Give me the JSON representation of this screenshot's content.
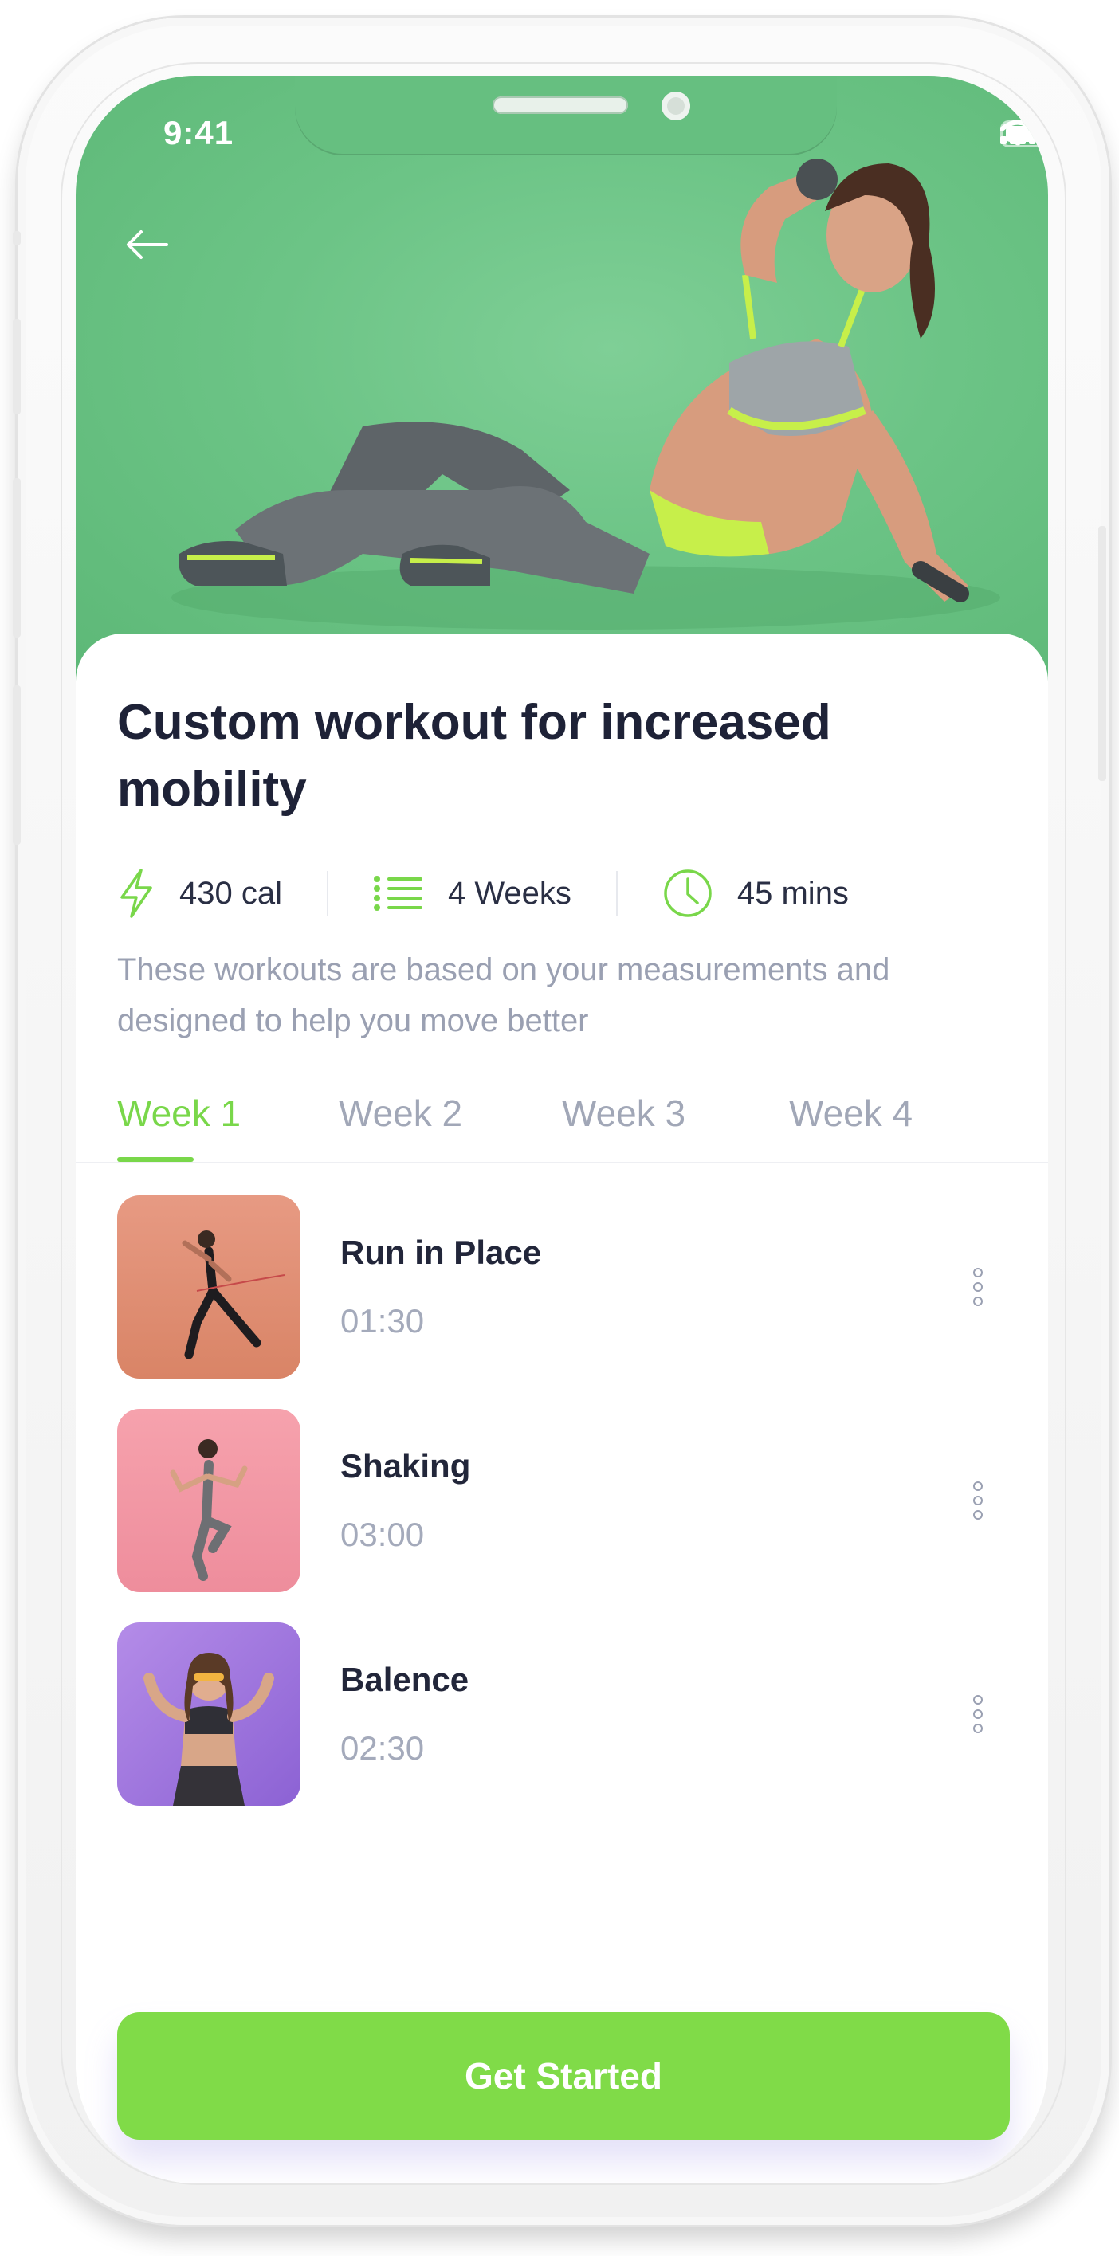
{
  "status_bar": {
    "time": "9:41",
    "icons": [
      "cellular-signal-icon",
      "wifi-icon",
      "battery-icon"
    ]
  },
  "header": {
    "back_icon": "arrow-left-icon"
  },
  "workout": {
    "title": "Custom workout for increased mobility",
    "stats": [
      {
        "icon": "lightning-icon",
        "value": "430 cal"
      },
      {
        "icon": "list-icon",
        "value": "4 Weeks"
      },
      {
        "icon": "clock-icon",
        "value": "45 mins"
      }
    ],
    "description": "These workouts are based on your measurements and designed to help you move better"
  },
  "tabs": [
    {
      "label": "Week 1",
      "active": true
    },
    {
      "label": "Week 2",
      "active": false
    },
    {
      "label": "Week 3",
      "active": false
    },
    {
      "label": "Week 4",
      "active": false
    }
  ],
  "exercises": [
    {
      "name": "Run in Place",
      "duration": "01:30"
    },
    {
      "name": "Shaking",
      "duration": "03:00"
    },
    {
      "name": "Balence",
      "duration": "02:30"
    }
  ],
  "cta": {
    "label": "Get Started"
  },
  "colors": {
    "accent": "#79d74a",
    "button": "#80db48",
    "hero_background": "#6cc486",
    "title_text": "#1e2237",
    "muted_text": "#9aa0b2"
  }
}
